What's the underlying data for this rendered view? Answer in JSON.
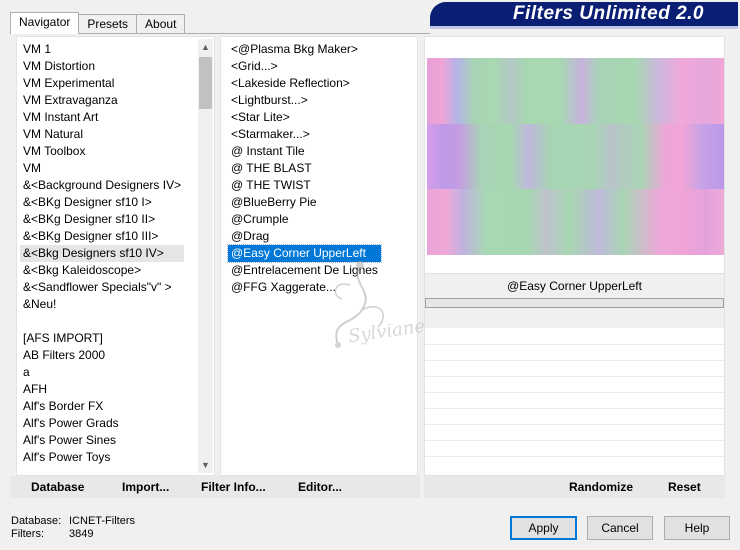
{
  "tabs": [
    {
      "label": "Navigator",
      "active": true
    },
    {
      "label": "Presets",
      "active": false
    },
    {
      "label": "About",
      "active": false
    }
  ],
  "brand": {
    "title": "Filters Unlimited 2.0"
  },
  "categories": {
    "items": [
      "VM 1",
      "VM Distortion",
      "VM Experimental",
      "VM Extravaganza",
      "VM Instant Art",
      "VM Natural",
      "VM Toolbox",
      "VM",
      "&<Background Designers IV>",
      "&<BKg Designer sf10 I>",
      "&<BKg Designer sf10 II>",
      "&<BKg Designer sf10 III>",
      "&<Bkg Designers sf10 IV>",
      "&<Bkg Kaleidoscope>",
      "&<Sandflower Specials\"v\" >",
      "&Neu!",
      "",
      "[AFS IMPORT]",
      "AB Filters 2000",
      "a",
      "AFH",
      "Alf's Border FX",
      "Alf's Power Grads",
      "Alf's Power Sines",
      "Alf's Power Toys"
    ],
    "highlighted_index": 12
  },
  "filters": {
    "items": [
      "<@Plasma Bkg Maker>",
      "<Grid...>",
      "<Lakeside Reflection>",
      "<Lightburst...>",
      "<Star Lite>",
      "<Starmaker...>",
      "@ Instant Tile",
      "@ THE BLAST",
      "@ THE TWIST",
      "@BlueBerry Pie",
      "@Crumple",
      "@Drag",
      "@Easy Corner UpperLeft",
      "@Entrelacement De Lignes",
      "@FFG Xaggerate..."
    ],
    "selected_index": 12
  },
  "preview": {
    "filter_name": "@Easy Corner UpperLeft"
  },
  "left_buttons": {
    "database": "Database",
    "import": "Import...",
    "filter_info": "Filter Info...",
    "editor": "Editor..."
  },
  "right_buttons": {
    "randomize": "Randomize",
    "reset": "Reset"
  },
  "status": {
    "database_label": "Database:",
    "database_value": "ICNET-Filters",
    "filters_label": "Filters:",
    "filters_value": "3849"
  },
  "dialog_buttons": {
    "apply": "Apply",
    "cancel": "Cancel",
    "help": "Help"
  },
  "icons": {
    "scroll_up": "scroll-up-arrow-icon",
    "scroll_down": "scroll-down-arrow-icon"
  }
}
